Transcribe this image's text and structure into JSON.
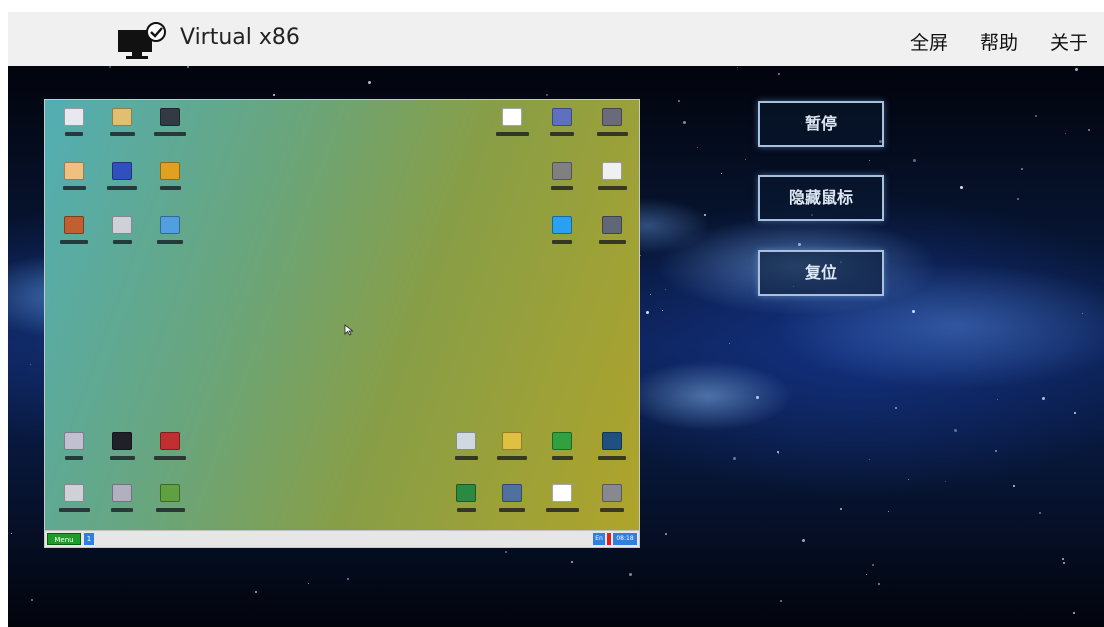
{
  "header": {
    "title": "Virtual x86",
    "nav": [
      "全屏",
      "帮助",
      "关于"
    ]
  },
  "controls": {
    "pause_label": "暂停",
    "hide_mouse_label": "隐藏鼠标",
    "reset_label": "复位"
  },
  "desktop": {
    "taskbar": {
      "menu_label": "Menu",
      "task_count": "1",
      "lang": "En",
      "clock": "08:18"
    },
    "icon_names": [
      "floppy-disk-icon",
      "folder-icon",
      "terminal-icon",
      "notes-icon",
      "calendar-app-icon",
      "close-tool-icon",
      "chart-app-icon",
      "calculator-icon",
      "image-viewer-icon",
      "media-app-icon",
      "monitor-app-icon",
      "network-icon",
      "satellite-dish-icon",
      "archive-icon",
      "bf-app-icon",
      "computer-icon",
      "disk-tool-icon",
      "display-settings-icon",
      "rubiks-cube-icon",
      "bubbles-icon",
      "bar-chart-app-icon",
      "snake-game-icon",
      "chip-icon",
      "grid-app-icon",
      "ship-app-icon",
      "dots-game-icon",
      "gear-settings-icon",
      "board-game-icon",
      "puzzle-icon",
      "tools-icon"
    ]
  },
  "colors": {
    "accent_border": "#a9c0dc",
    "topbar_bg": "#f0f0f0",
    "menu_green": "#1f9b2a",
    "taskbar_blue": "#2e7fe0"
  }
}
